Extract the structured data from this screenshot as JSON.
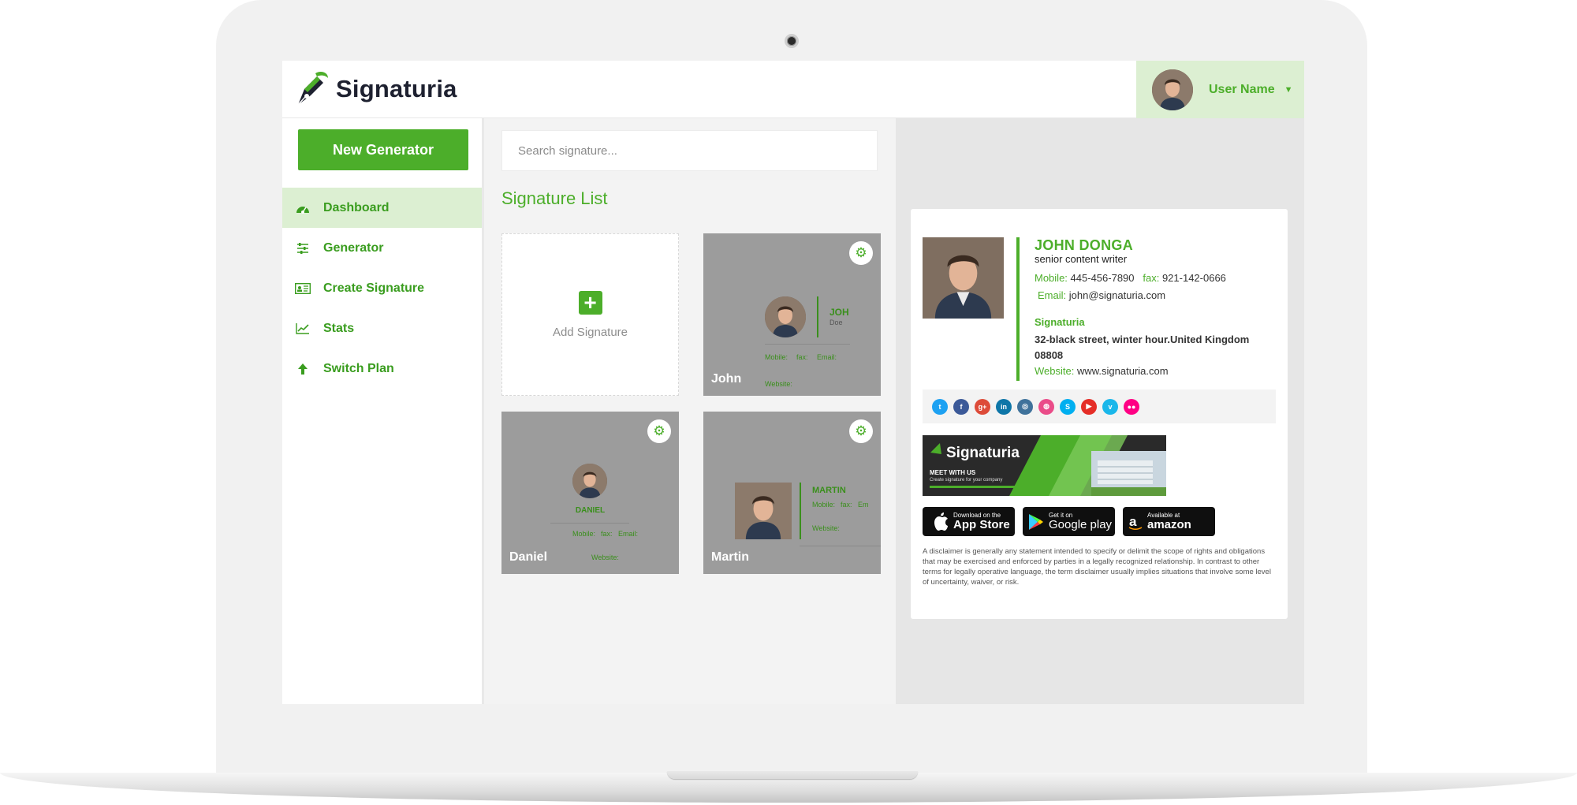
{
  "app": {
    "logo_text": "Signaturia",
    "user_name": "User Name"
  },
  "sidebar": {
    "new_generator_label": "New Generator",
    "items": [
      {
        "label": "Dashboard",
        "icon": "dashboard-icon",
        "active": true
      },
      {
        "label": "Generator",
        "icon": "sliders-icon",
        "active": false
      },
      {
        "label": "Create Signature",
        "icon": "id-card-icon",
        "active": false
      },
      {
        "label": "Stats",
        "icon": "line-chart-icon",
        "active": false
      },
      {
        "label": "Switch Plan",
        "icon": "arrow-up-icon",
        "active": false
      }
    ]
  },
  "main": {
    "search_placeholder": "Search signature...",
    "list_title": "Signature List",
    "add_signature_label": "Add Signature",
    "cards": [
      {
        "name": "John",
        "mini_name": "JOH",
        "mini_sub": "Doe",
        "mini_contacts": [
          "Mobile:",
          "fax:",
          "Email:"
        ],
        "mini_website": "Website:"
      },
      {
        "name": "Daniel",
        "mini_name": "DANIEL",
        "mini_contacts": [
          "Mobile:",
          "fax:",
          "Email:"
        ],
        "mini_website": "Website:"
      },
      {
        "name": "Martin",
        "mini_name": "MARTIN",
        "mini_contacts": [
          "Mobile:",
          "fax:",
          "Em"
        ],
        "mini_website": "Website:"
      }
    ]
  },
  "preview": {
    "name": "JOHN DONGA",
    "role": "senior content writer",
    "mobile_label": "Mobile:",
    "mobile": "445-456-7890",
    "fax_label": "fax:",
    "fax": "921-142-0666",
    "email_label": "Email:",
    "email": "john@signaturia.com",
    "company": "Signaturia",
    "address": "32-black street, winter hour.United Kingdom 08808",
    "website_label": "Website:",
    "website": "www.signaturia.com",
    "social": [
      {
        "icon": "twitter-icon",
        "glyph": "t",
        "color": "#1da1f2"
      },
      {
        "icon": "facebook-icon",
        "glyph": "f",
        "color": "#3b5998"
      },
      {
        "icon": "google-plus-icon",
        "glyph": "g+",
        "color": "#dd4b39"
      },
      {
        "icon": "linkedin-icon",
        "glyph": "in",
        "color": "#0e76a8"
      },
      {
        "icon": "instagram-icon",
        "glyph": "◎",
        "color": "#3f729b"
      },
      {
        "icon": "dribbble-icon",
        "glyph": "◍",
        "color": "#ea4c89"
      },
      {
        "icon": "skype-icon",
        "glyph": "S",
        "color": "#00aff0"
      },
      {
        "icon": "youtube-icon",
        "glyph": "▶",
        "color": "#e52d27"
      },
      {
        "icon": "vimeo-icon",
        "glyph": "v",
        "color": "#1ab7ea"
      },
      {
        "icon": "flickr-icon",
        "glyph": "●●",
        "color": "#ff0084"
      }
    ],
    "banner": {
      "brand": "Signaturia",
      "headline": "MEET WITH US",
      "subline": "Create signature for your company"
    },
    "stores": [
      {
        "small": "Download on the",
        "big": "App Store",
        "icon": "apple-icon"
      },
      {
        "small": "Get it on",
        "big": "Google play",
        "icon": "google-play-icon"
      },
      {
        "small": "Available at",
        "big": "amazon",
        "icon": "amazon-icon"
      }
    ],
    "disclaimer": "A disclaimer is generally any statement intended to specify or delimit the scope of rights and obligations that may be exercised and enforced by parties in a legally recognized relationship. In contrast to other terms for legally operative language, the term disclaimer usually implies situations that involve some level of uncertainty, waiver, or risk."
  },
  "colors": {
    "brand_green": "#4cae2a",
    "active_bg": "#dcefd2",
    "card_gray": "#9c9c9c"
  }
}
